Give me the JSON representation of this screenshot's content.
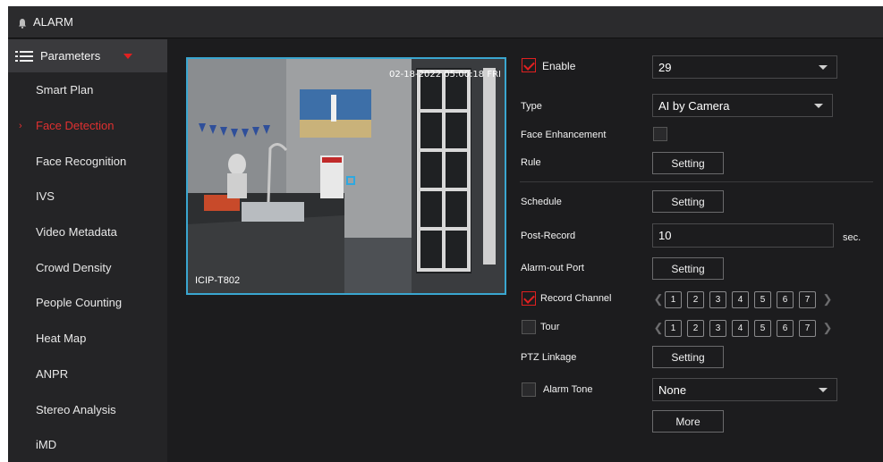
{
  "window": {
    "title": "ALARM"
  },
  "sidebar": {
    "header": "Parameters",
    "items": [
      {
        "label": "Smart Plan",
        "active": false
      },
      {
        "label": "Face Detection",
        "active": true
      },
      {
        "label": "Face Recognition",
        "active": false
      },
      {
        "label": "IVS",
        "active": false
      },
      {
        "label": "Video Metadata",
        "active": false
      },
      {
        "label": "Crowd Density",
        "active": false
      },
      {
        "label": "People Counting",
        "active": false
      },
      {
        "label": "Heat Map",
        "active": false
      },
      {
        "label": "ANPR",
        "active": false
      },
      {
        "label": "Stereo Analysis",
        "active": false
      },
      {
        "label": "iMD",
        "active": false
      }
    ]
  },
  "preview": {
    "timestamp": "02-18-2022 05:00:18 FRI",
    "camera_name": "ICIP-T802"
  },
  "form": {
    "enable": {
      "label": "Enable",
      "checked": true
    },
    "channel": {
      "value": "29"
    },
    "type": {
      "label": "Type",
      "value": "AI by Camera"
    },
    "face_enhancement": {
      "label": "Face Enhancement",
      "checked": false
    },
    "rule": {
      "label": "Rule",
      "button": "Setting"
    },
    "schedule": {
      "label": "Schedule",
      "button": "Setting"
    },
    "post_record": {
      "label": "Post-Record",
      "value": "10",
      "unit": "sec."
    },
    "alarm_out": {
      "label": "Alarm-out Port",
      "button": "Setting"
    },
    "record_channel": {
      "label": "Record Channel",
      "checked": true,
      "channels": [
        "1",
        "2",
        "3",
        "4",
        "5",
        "6",
        "7"
      ]
    },
    "tour": {
      "label": "Tour",
      "checked": false,
      "channels": [
        "1",
        "2",
        "3",
        "4",
        "5",
        "6",
        "7"
      ]
    },
    "ptz": {
      "label": "PTZ Linkage",
      "button": "Setting"
    },
    "alarm_tone": {
      "label": "Alarm Tone",
      "checked": false,
      "value": "None"
    },
    "more": {
      "button": "More"
    }
  },
  "icons": {
    "bell": "bell-icon",
    "list": "list-icon",
    "prev": "chevron-left-icon",
    "next": "chevron-right-icon"
  },
  "colors": {
    "accent": "#e02020",
    "preview_border": "#3aa6d0",
    "background": "#1c1c1e"
  }
}
